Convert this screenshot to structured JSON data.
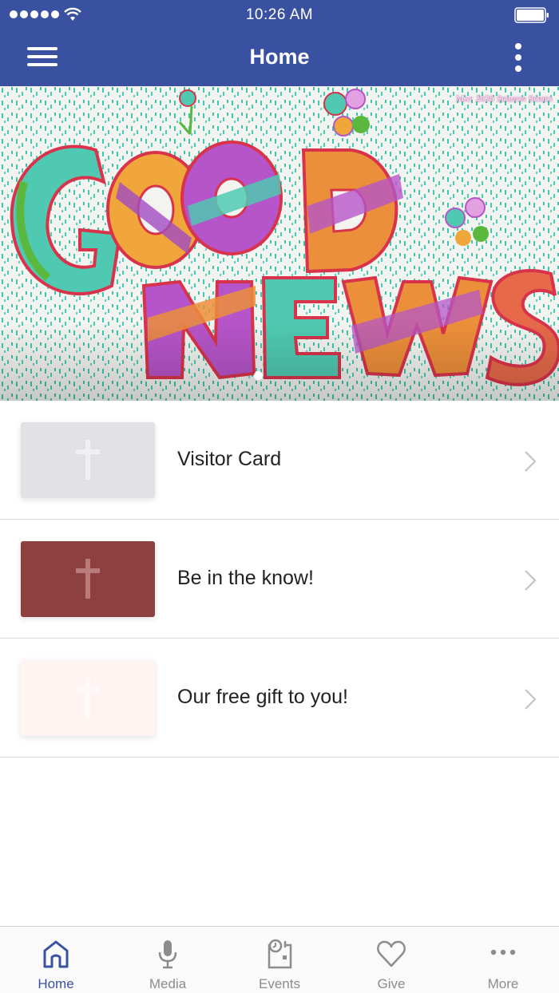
{
  "status_bar": {
    "time": "10:26 AM"
  },
  "nav": {
    "title": "Home"
  },
  "hero": {
    "caption": "May 2020 Sermon Series",
    "title_art": "GOOD NEWS",
    "slide_count": 1,
    "active_slide": 1
  },
  "items": [
    {
      "label": "Visitor Card",
      "thumb_color": "#e2e1e6",
      "cross_color": "#f0eff3"
    },
    {
      "label": "Be in the know!",
      "thumb_color": "#8e3f40",
      "cross_color": "#b87b7a"
    },
    {
      "label": "Our free gift to you!",
      "thumb_color": "#fff4f1",
      "cross_color": "#fffaf8"
    }
  ],
  "tabs": [
    {
      "label": "Home",
      "icon": "home-icon",
      "active": true
    },
    {
      "label": "Media",
      "icon": "microphone-icon",
      "active": false
    },
    {
      "label": "Events",
      "icon": "calendar-clock-icon",
      "active": false
    },
    {
      "label": "Give",
      "icon": "heart-icon",
      "active": false
    },
    {
      "label": "More",
      "icon": "more-dots-icon",
      "active": false
    }
  ],
  "colors": {
    "brand": "#3a51a2",
    "tab_inactive": "#8c8c8c"
  }
}
